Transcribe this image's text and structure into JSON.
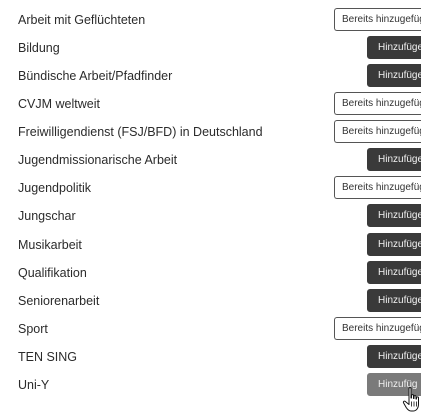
{
  "items": [
    {
      "label": "Arbeit mit Geflüchteten",
      "button": "Bereits hinzugefüg",
      "state": "added"
    },
    {
      "label": "Bildung",
      "button": "Hinzufüge",
      "state": "add"
    },
    {
      "label": "Bündische Arbeit/Pfadfinder",
      "button": "Hinzufüge",
      "state": "add"
    },
    {
      "label": "CVJM weltweit",
      "button": "Bereits hinzugefüg",
      "state": "added"
    },
    {
      "label": "Freiwilligendienst (FSJ/BFD) in Deutschland",
      "button": "Bereits hinzugefüg",
      "state": "added"
    },
    {
      "label": "Jugendmissionarische Arbeit",
      "button": "Hinzufüge",
      "state": "add"
    },
    {
      "label": "Jugendpolitik",
      "button": "Bereits hinzugefüg",
      "state": "added"
    },
    {
      "label": "Jungschar",
      "button": "Hinzufüge",
      "state": "add"
    },
    {
      "label": "Musikarbeit",
      "button": "Hinzufüge",
      "state": "add"
    },
    {
      "label": "Qualifikation",
      "button": "Hinzufüge",
      "state": "add"
    },
    {
      "label": "Seniorenarbeit",
      "button": "Hinzufüge",
      "state": "add"
    },
    {
      "label": "Sport",
      "button": "Bereits hinzugefüg",
      "state": "added"
    },
    {
      "label": "TEN SING",
      "button": "Hinzufüge",
      "state": "add"
    },
    {
      "label": "Uni-Y",
      "button": "Hinzufüg",
      "state": "add-hover"
    }
  ],
  "colors": {
    "add_button_bg": "#3a3a3a",
    "add_button_hover_bg": "#7a7a7a",
    "added_button_border": "#555555",
    "text": "#2b2b2b"
  },
  "icons": {
    "cursor": "hand-pointer-icon"
  }
}
